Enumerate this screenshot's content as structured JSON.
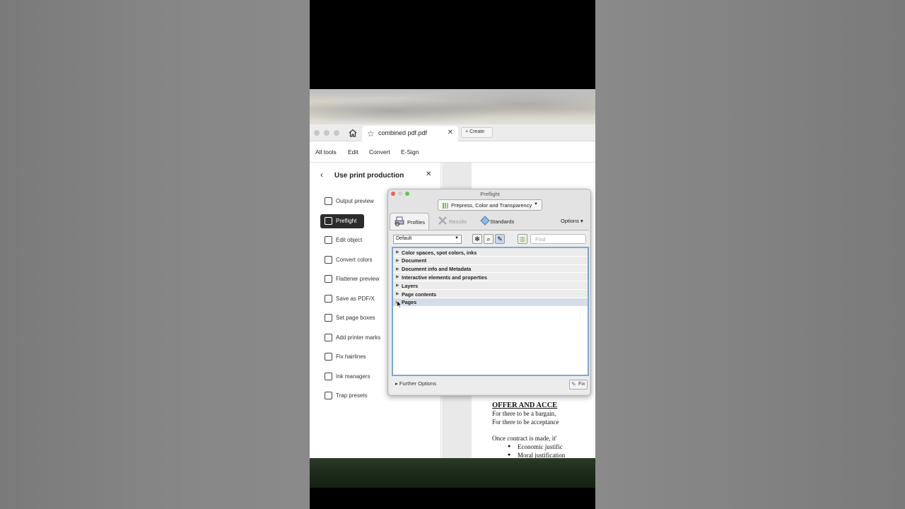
{
  "tab": {
    "title": "combined pdf.pdf",
    "create_label": "Create"
  },
  "menu": [
    "All tools",
    "Edit",
    "Convert",
    "E-Sign"
  ],
  "panel": {
    "title": "Use print production",
    "tools": [
      "Output preview",
      "Preflight",
      "Edit object",
      "Convert colors",
      "Flattener preview",
      "Save as PDF/X",
      "Set page boxes",
      "Add printer marks",
      "Fix hairlines",
      "Ink managers",
      "Trap presets"
    ],
    "active_tool": "Preflight"
  },
  "dialog": {
    "title": "Preflight",
    "profile": "Prepress, Color and Transparency",
    "tabs": [
      "Profiles",
      "Results",
      "Standards"
    ],
    "options_label": "Options",
    "set_label": "Default",
    "find_placeholder": "Find",
    "tree": [
      "Color spaces, spot colors, inks",
      "Document",
      "Document info and Metadata",
      "Interactive elements and properties",
      "Layers",
      "Page contents",
      "Pages"
    ],
    "further_options": "Further Options",
    "fix_label": "Fix"
  },
  "document": {
    "heading": "OFFER AND ACCE",
    "lines": [
      "For there to be a bargain,",
      "For there to be acceptance",
      "Once contract is made, it'"
    ],
    "bullets": [
      "Economic justific",
      "Moral justification"
    ]
  },
  "colors": {
    "active_tool_bg": "#2c2c2c",
    "tree_border": "#7fa7cf",
    "close_red": "#ec5f57",
    "min_yellow": "#f5be4f",
    "max_green": "#60c554"
  }
}
